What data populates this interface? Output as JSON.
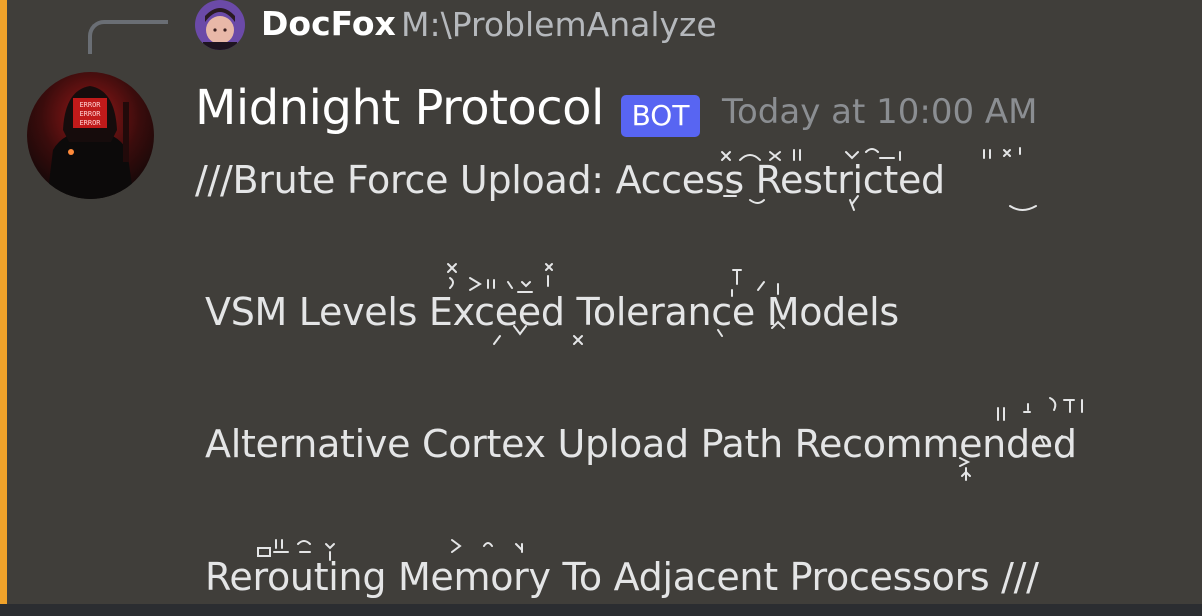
{
  "reply": {
    "author": "DocFox",
    "snippet": "M:\\ProblemAnalyze"
  },
  "message": {
    "author": "Midnight Protocol",
    "badge": "BOT",
    "timestamp": "Today at 10:00 AM",
    "lines": [
      "///Brute Force Upload: Access Restricted",
      "VSM Levels Exceed Tolerance Models",
      "Alternative Cortex Upload Path Recommended",
      "Rerouting Memory To Adjacent Processors ///"
    ]
  },
  "colors": {
    "accent_bar": "#f0a22a",
    "background": "#403e3a",
    "bot_badge": "#5865f2",
    "timestamp": "#8b8e92",
    "snippet": "#b5b8bc"
  },
  "icons": {
    "reply_connector": "reply-spine-icon",
    "reply_avatar": "user-avatar",
    "author_avatar": "hooded-hacker-avatar"
  }
}
